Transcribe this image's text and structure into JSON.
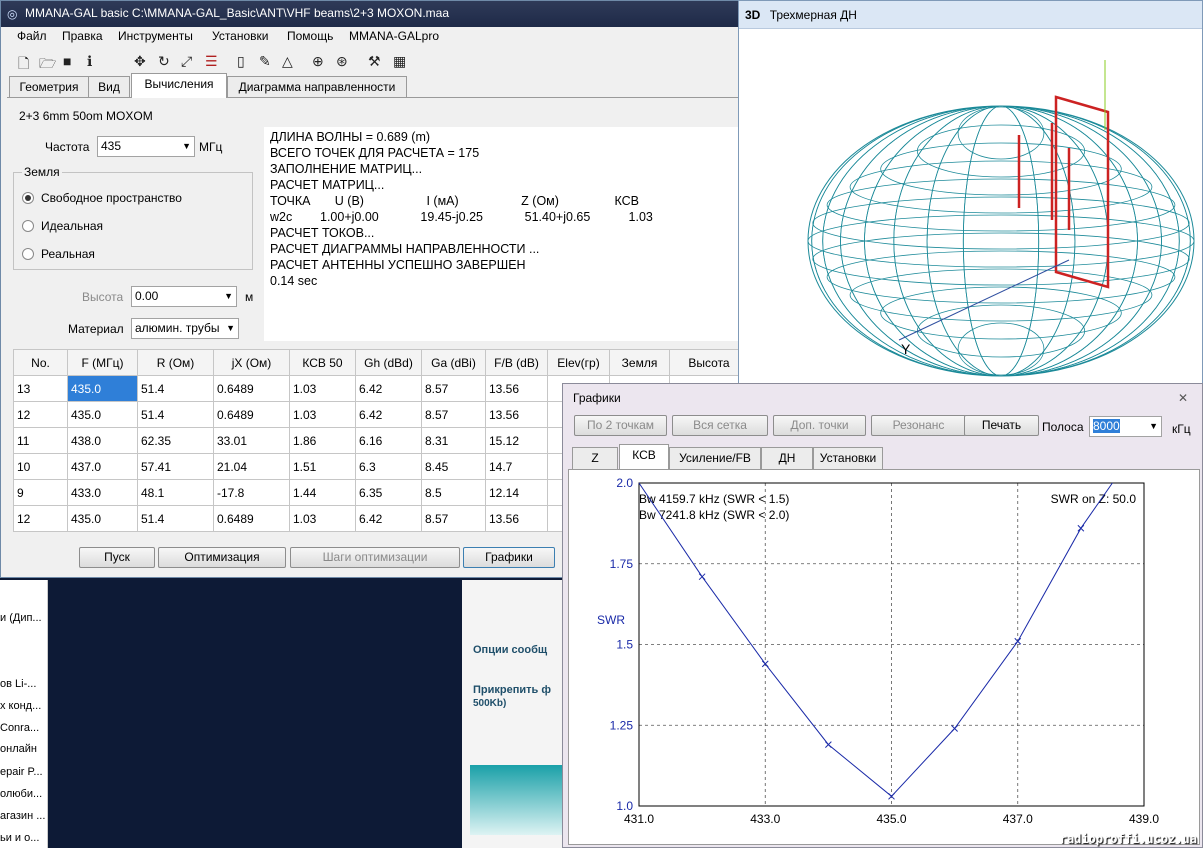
{
  "background": {
    "left_list": [
      "и (Дип...",
      "ов Li-...",
      "х конд...",
      "Conra...",
      "онлайн",
      "epair P...",
      "олюби...",
      "агазин ...",
      "ьи и о..."
    ],
    "forum_options": "Опции сообщ",
    "forum_attach": "Прикрепить ф",
    "forum_attach_note": "500Kb)"
  },
  "main": {
    "title": "MMANA-GAL basic C:\\MMANA-GAL_Basic\\ANT\\VHF beams\\2+3 MOXON.maa",
    "menu": [
      "Файл",
      "Правка",
      "Инструменты",
      "Установки",
      "Помощь",
      "MMANA-GALpro"
    ],
    "toolbar_icons": [
      "new-icon",
      "open-icon",
      "save-icon",
      "info-icon",
      "move-icon",
      "rotate-icon",
      "scale-icon",
      "wires-icon",
      "doc-icon",
      "pen-icon",
      "triangle-icon",
      "target-icon",
      "tools-icon",
      "calculator-icon"
    ],
    "tabs": [
      "Геометрия",
      "Вид",
      "Вычисления",
      "Диаграмма направленности"
    ],
    "active_tab": "Вычисления",
    "antenna_name": "2+3 6mm  50om  MOXOM",
    "freq_label": "Частота",
    "freq_value": "435",
    "freq_unit": "МГц",
    "ground_group": "Земля",
    "ground_options": [
      "Свободное пространство",
      "Идеальная",
      "Реальная"
    ],
    "ground_selected": 0,
    "height_label": "Высота",
    "height_value": "0.00",
    "height_unit": "м",
    "material_label": "Материал",
    "material_value": "алюмин. трубы",
    "log": [
      "ДЛИНА ВОЛНЫ = 0.689 (m)",
      "ВСЕГО ТОЧЕК ДЛЯ РАСЧЕТА = 175",
      "ЗАПОЛНЕНИЕ МАТРИЦ...",
      "РАСЧЕТ МАТРИЦ...",
      "ТОЧКА       U (B)                  I (мА)                  Z (Ом)                КСВ",
      "w2c        1.00+j0.00            19.45-j0.25            51.40+j0.65           1.03",
      "РАСЧЕТ ТОКОВ...",
      "РАСЧЕТ ДИАГРАММЫ НАПРАВЛЕННОСТИ ...",
      "РАСЧЕТ АНТЕННЫ УСПЕШНО ЗАВЕРШЕН",
      "0.14 sec"
    ],
    "table": {
      "headers": [
        "No.",
        "F (МГц)",
        "R (Ом)",
        "jX (Ом)",
        "КСВ 50",
        "Gh (dBd)",
        "Ga (dBi)",
        "F/B (dB)",
        "Elev(гр)",
        "Земля",
        "Высота"
      ],
      "rows": [
        [
          "13",
          "435.0",
          "51.4",
          "0.6489",
          "1.03",
          "6.42",
          "8.57",
          "13.56"
        ],
        [
          "12",
          "435.0",
          "51.4",
          "0.6489",
          "1.03",
          "6.42",
          "8.57",
          "13.56"
        ],
        [
          "11",
          "438.0",
          "62.35",
          "33.01",
          "1.86",
          "6.16",
          "8.31",
          "15.12"
        ],
        [
          "10",
          "437.0",
          "57.41",
          "21.04",
          "1.51",
          "6.3",
          "8.45",
          "14.7"
        ],
        [
          "9",
          "433.0",
          "48.1",
          "-17.8",
          "1.44",
          "6.35",
          "8.5",
          "12.14"
        ],
        [
          "12",
          "435.0",
          "51.4",
          "0.6489",
          "1.03",
          "6.42",
          "8.57",
          "13.56"
        ]
      ]
    },
    "buttons": [
      "Пуск",
      "Оптимизация",
      "Шаги оптимизации",
      "Графики"
    ]
  },
  "view3d": {
    "title_icon": "3D",
    "title": "Трехмерная ДН",
    "axis_y": "Y"
  },
  "graphs": {
    "title": "Графики",
    "close": "✕",
    "buttons": [
      "По 2 точкам",
      "Вся сетка",
      "Доп. точки",
      "Резонанс",
      "Печать"
    ],
    "band_label": "Полоса",
    "band_value": "8000",
    "band_unit": "кГц",
    "tabs": [
      "Z",
      "КСВ",
      "Усиление/FB",
      "ДН",
      "Установки"
    ],
    "active_tab": "КСВ"
  },
  "watermark": "radioproffi.ucoz.ua",
  "chart_data": {
    "type": "line",
    "ylabel": "SWR",
    "xlim": [
      431.0,
      439.0
    ],
    "ylim": [
      1.0,
      2.0
    ],
    "x_ticks": [
      "431.0",
      "433.0",
      "435.0",
      "437.0",
      "439.0"
    ],
    "y_ticks": [
      "2.0",
      "1.75",
      "1.5",
      "1.25",
      "1.0"
    ],
    "x_tick_values": [
      431,
      433,
      435,
      437,
      439
    ],
    "y_tick_values": [
      2.0,
      1.75,
      1.5,
      1.25,
      1.0
    ],
    "grid": true,
    "annotations": [
      "Bw 4159.7 kHz (SWR < 1.5)",
      "Bw 7241.8 kHz (SWR < 2.0)",
      "SWR on Z: 50.0"
    ],
    "series": [
      {
        "x": [
          431.0,
          432.0,
          433.0,
          434.0,
          435.0,
          436.0,
          437.0,
          438.0,
          438.5
        ],
        "values": [
          2.0,
          1.71,
          1.44,
          1.19,
          1.03,
          1.24,
          1.51,
          1.86,
          2.0
        ]
      }
    ],
    "markers_x": [
      432.0,
      433.0,
      434.0,
      435.0,
      436.0,
      437.0,
      438.0
    ]
  }
}
